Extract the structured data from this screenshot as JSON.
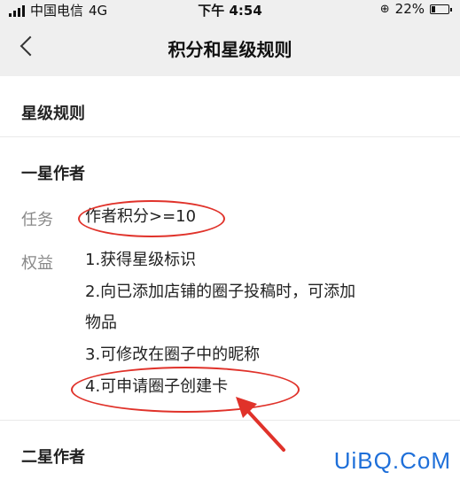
{
  "status_bar": {
    "carrier": "中国电信",
    "network": "4G",
    "time": "下午 4:54",
    "battery_percent": "22%",
    "battery_level": 0.22,
    "icons": [
      "signal-icon",
      "orientation-lock-icon",
      "battery-icon"
    ]
  },
  "nav": {
    "title": "积分和星级规则",
    "back_icon": "chevron-left-icon"
  },
  "section": {
    "title": "星级规则"
  },
  "levels": [
    {
      "name": "一星作者",
      "task_label": "任务",
      "task_value": "作者积分>=10",
      "benefit_label": "权益",
      "benefits": [
        "1.获得星级标识",
        "2.向已添加店铺的圈子投稿时，可添加",
        "物品",
        "3.可修改在圈子中的昵称",
        "4.可申请圈子创建卡"
      ]
    },
    {
      "name": "二星作者"
    }
  ],
  "annotations": {
    "color": "#e0322a"
  },
  "watermark": "UiBQ.CoM"
}
